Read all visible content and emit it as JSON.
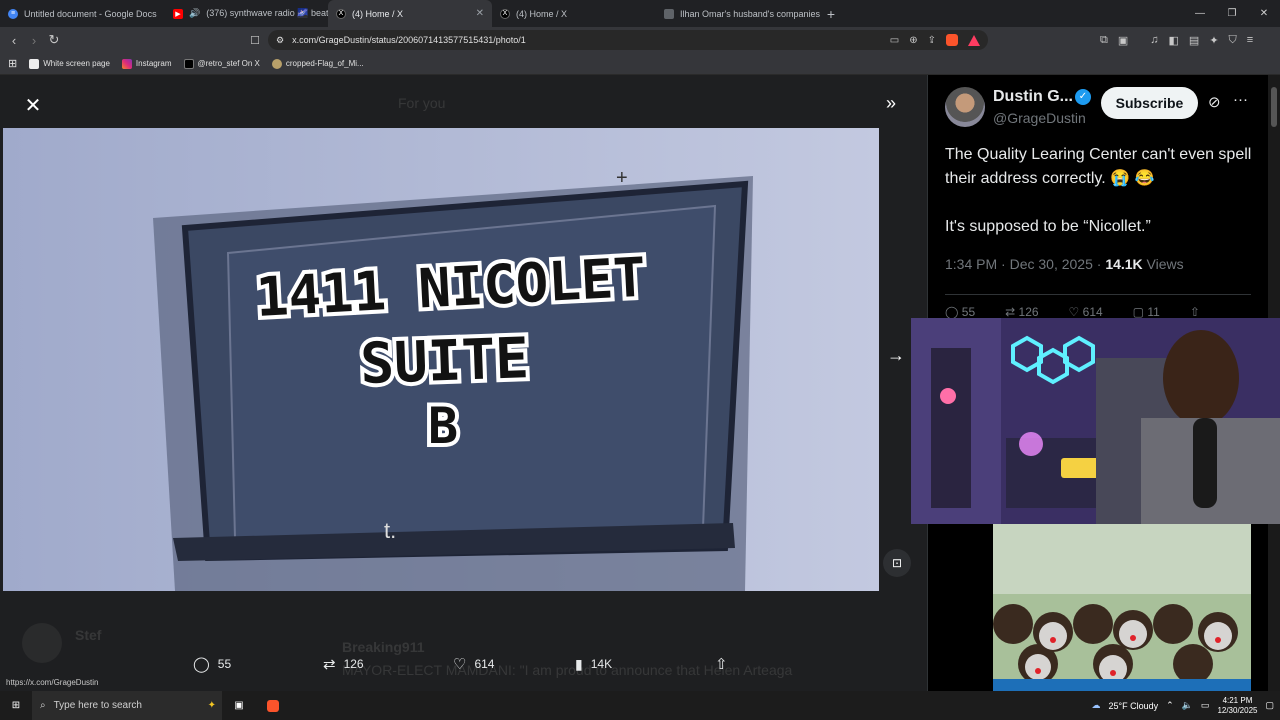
{
  "browser": {
    "tabs": [
      {
        "title": "Untitled document - Google Docs",
        "icon": "docs-icon"
      },
      {
        "title": "(376) synthwave radio 🌌 beats t",
        "icon": "youtube-icon"
      },
      {
        "title": "(4) Home / X",
        "icon": "x-icon"
      },
      {
        "title": "(4) Home / X",
        "icon": "x-icon"
      },
      {
        "title": "Ilhan Omar's husband's companies s",
        "icon": "page-icon"
      }
    ],
    "url": "x.com/GrageDustin/status/2006071413577515431/photo/1",
    "bookmarks": [
      "White screen page",
      "Instagram",
      "@retro_stef On X",
      "cropped-Flag_of_Mi..."
    ]
  },
  "viewer": {
    "ghost_header": "For you",
    "sign": {
      "line1": "1411 NICOLET",
      "line2": "SUITE",
      "line3": "B"
    },
    "actions": {
      "replies": "55",
      "reposts": "126",
      "likes": "614",
      "views": "14K"
    },
    "background_feed": {
      "name1": "Stef",
      "name2": "Breaking911",
      "snippet": "MAYOR-ELECT MAMDANI: \"I am proud to announce that Helen Arteaga"
    },
    "status_url": "https://x.com/GrageDustin"
  },
  "tweet": {
    "display_name": "Dustin G...",
    "handle": "@GrageDustin",
    "subscribe_label": "Subscribe",
    "text_line1": "The Quality Learing Center can't even spell their address correctly. 😭 😂",
    "text_line2": "It's supposed to be “Nicollet.”",
    "time": "1:34 PM · Dec 30, 2025 · ",
    "views_count": "14.1K",
    "views_label": " Views",
    "stats": {
      "replies": "55",
      "reposts": "126",
      "likes": "614",
      "bookmarks": "11"
    }
  },
  "taskbar": {
    "search_placeholder": "Type here to search",
    "weather": "25°F  Cloudy",
    "time": "4:21 PM",
    "date": "12/30/2025"
  },
  "colors": {
    "accent": "#1d9bf0",
    "x_bg": "#000000",
    "sign_bg": "#3b4863"
  }
}
